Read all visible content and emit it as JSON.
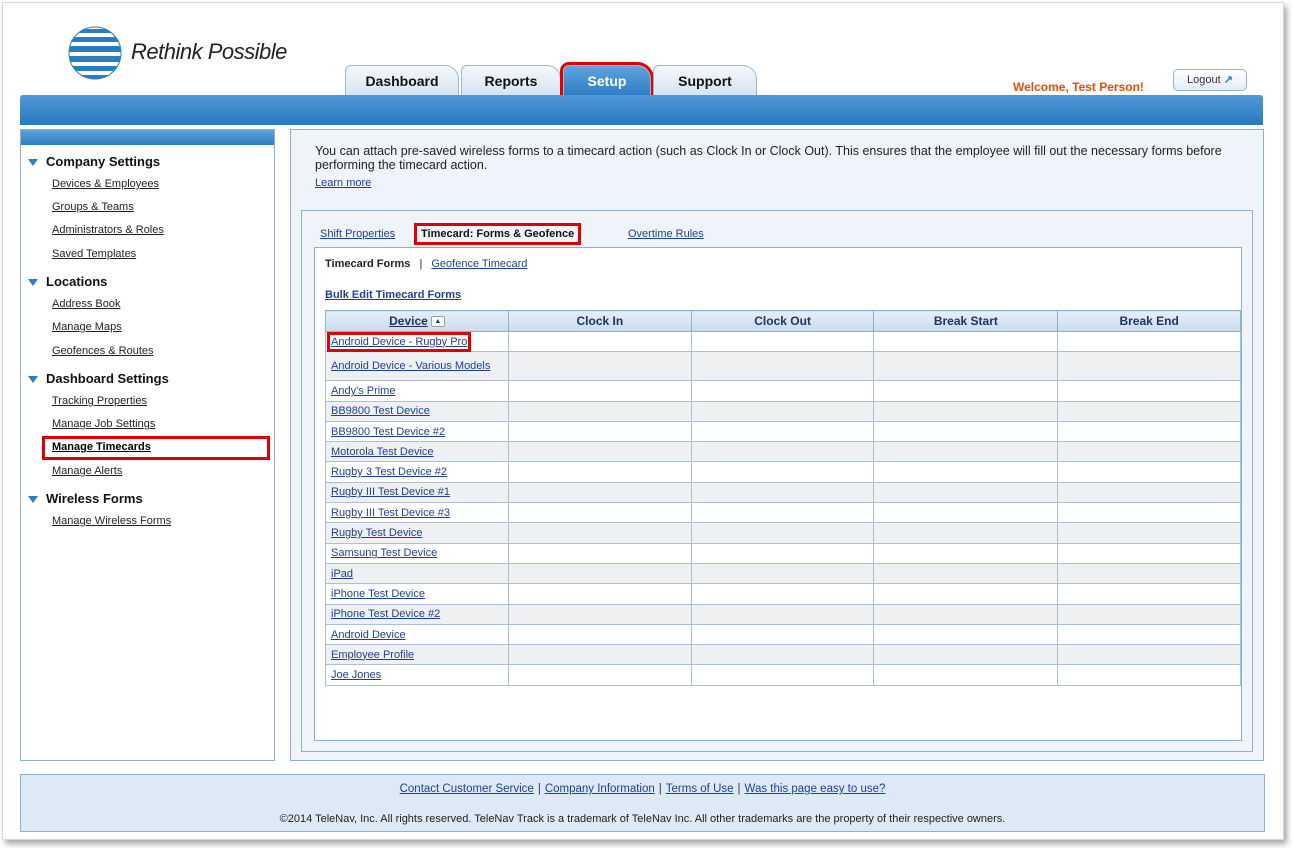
{
  "header": {
    "brand": "Rethink Possible",
    "tabs": [
      {
        "label": "Dashboard"
      },
      {
        "label": "Reports"
      },
      {
        "label": "Setup"
      },
      {
        "label": "Support"
      }
    ],
    "welcome": "Welcome, Test Person!",
    "logout": "Logout"
  },
  "sidebar": {
    "sections": [
      {
        "title": "Company Settings",
        "items": [
          "Devices & Employees",
          "Groups & Teams",
          "Administrators & Roles",
          "Saved Templates"
        ]
      },
      {
        "title": "Locations",
        "items": [
          "Address Book",
          "Manage Maps",
          "Geofences & Routes"
        ]
      },
      {
        "title": "Dashboard Settings",
        "items": [
          "Tracking Properties",
          "Manage Job Settings",
          "Manage Timecards",
          "Manage Alerts"
        ]
      },
      {
        "title": "Wireless Forms",
        "items": [
          "Manage Wireless Forms"
        ]
      }
    ],
    "active_item": "Manage Timecards"
  },
  "main": {
    "intro": "You can attach pre-saved wireless forms to a timecard action (such as Clock In or Clock Out). This ensures that the employee will fill out the necessary forms before performing the timecard action.",
    "learn_more": "Learn more",
    "subtabs": [
      "Shift Properties",
      "Timecard: Forms & Geofence",
      "Overtime Rules"
    ],
    "form_tabs": {
      "active": "Timecard Forms",
      "separator": "|",
      "other": "Geofence Timecard"
    },
    "bulk_edit": "Bulk Edit Timecard Forms",
    "table": {
      "columns": [
        "Device",
        "Clock In",
        "Clock Out",
        "Break Start",
        "Break End"
      ],
      "rows": [
        "Android Device - Rugby Pro",
        "Android Device - Various Models",
        "Andy's Prime",
        "BB9800 Test Device",
        "BB9800 Test Device #2",
        "Motorola Test Device",
        "Rugby 3 Test Device #2",
        "Rugby III Test Device #1",
        "Rugby III Test Device #3",
        "Rugby Test Device",
        "Samsung Test Device",
        "iPad",
        "iPhone Test Device",
        "iPhone Test Device #2",
        "Android Device",
        "Employee Profile",
        "Joe Jones"
      ]
    }
  },
  "footer": {
    "links": [
      "Contact Customer Service",
      "Company Information",
      "Terms of Use",
      "Was this page easy to use?"
    ],
    "copyright": "©2014 TeleNav, Inc. All rights reserved. TeleNav Track is a trademark of TeleNav Inc. All other trademarks are the property of their respective owners."
  },
  "colors": {
    "accent": "#2f7dc4",
    "highlight": "#e00000",
    "welcome": "#e64a10"
  }
}
